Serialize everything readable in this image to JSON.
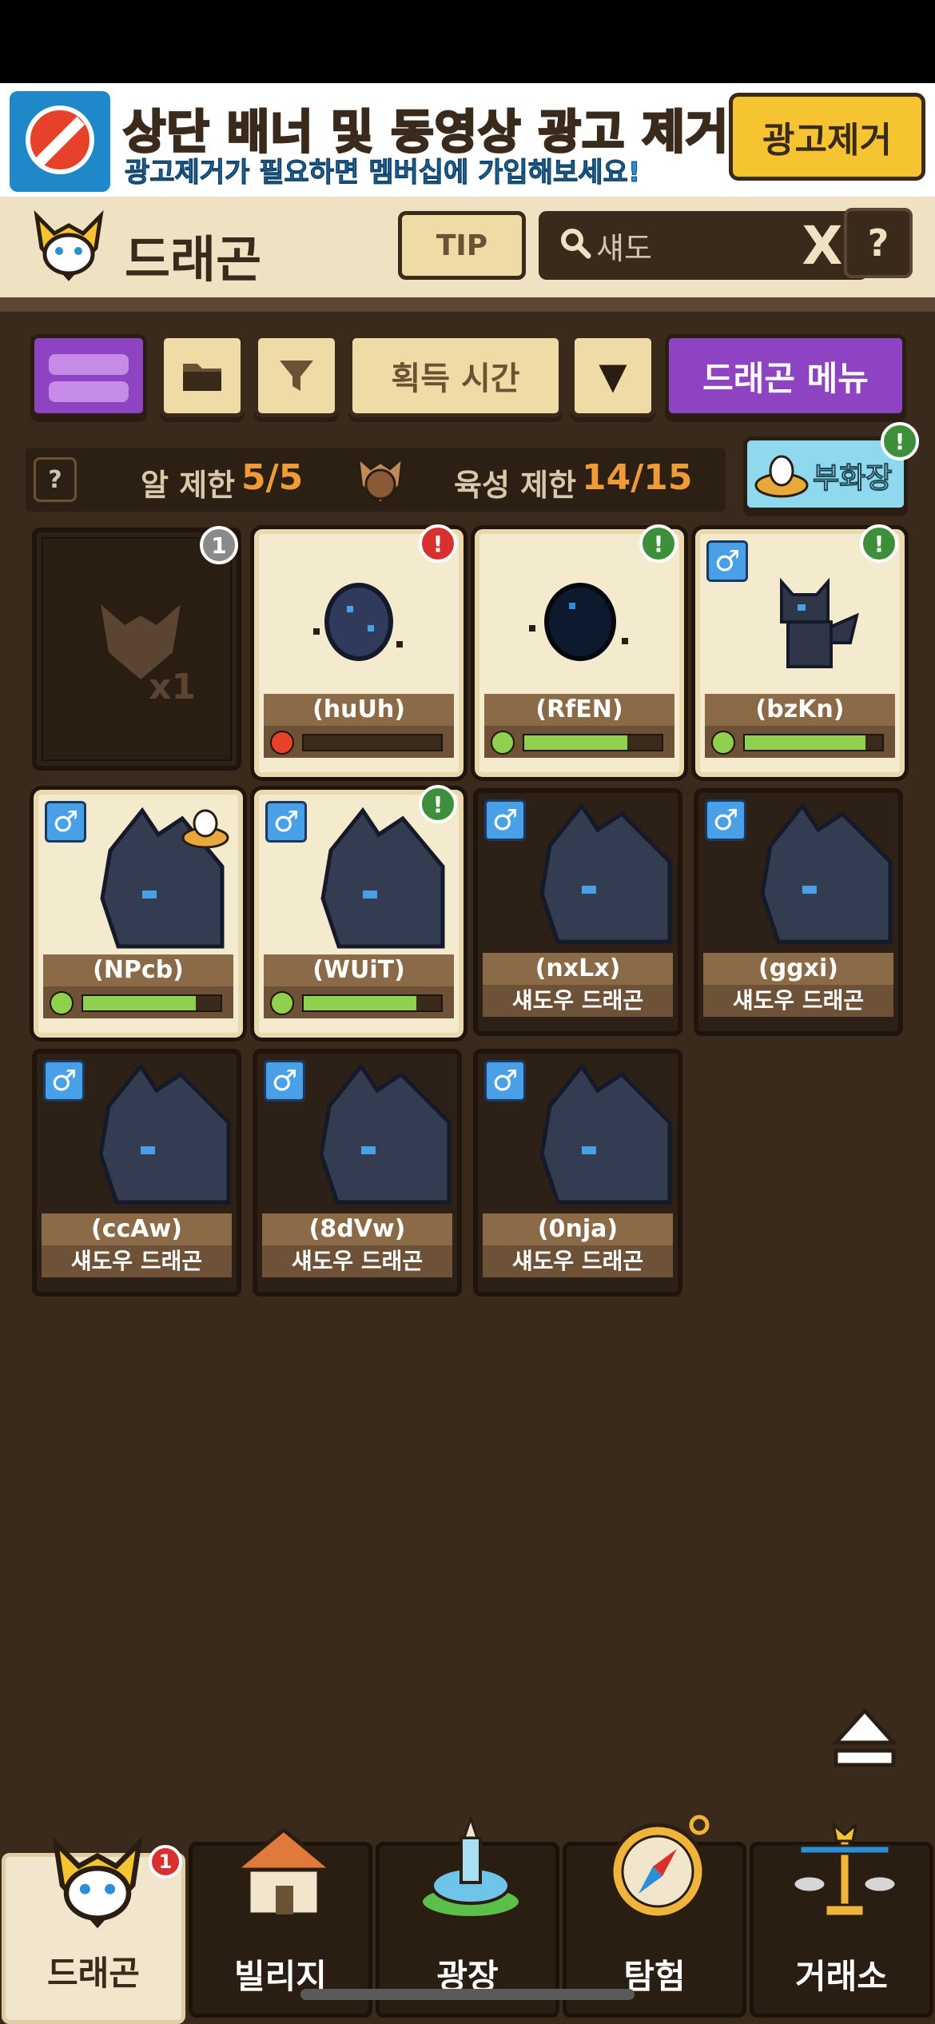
{
  "banner": {
    "title": "상단 배너 및 동영상 광고 제거!",
    "subtitle": "광고제거가 필요하면 멤버십에 가입해보세요!",
    "button_label": "광고제거"
  },
  "header": {
    "title": "드래곤",
    "tip_label": "TIP",
    "search_value": "섀도",
    "clear_label": "X",
    "help_label": "?"
  },
  "toolbar": {
    "sort_label": "획득 시간",
    "sort_dir": "▼",
    "menu_label": "드래곤 메뉴"
  },
  "limits": {
    "help_label": "?",
    "egg_label": "알 제한",
    "egg_value": "5/5",
    "raise_label": "육성 제한",
    "raise_value": "14/15",
    "nursery_label": "부화장",
    "nursery_badge": "!"
  },
  "cards": [
    {
      "type": "placeholder",
      "count": "x1",
      "badge": "1"
    },
    {
      "type": "egg",
      "name": "(huUh)",
      "hp": 0.0,
      "mood": "angry",
      "badge": "!"
    },
    {
      "type": "egg",
      "name": "(RfEN)",
      "hp": 0.75,
      "mood": "happy",
      "badge": "!"
    },
    {
      "type": "baby",
      "name": "(bzKn)",
      "hp": 0.88,
      "mood": "happy",
      "badge": "!",
      "gender": "♂"
    },
    {
      "type": "adult",
      "name": "(NPcb)",
      "hp": 0.82,
      "mood": "happy",
      "gender": "♂"
    },
    {
      "type": "adult",
      "name": "(WUiT)",
      "hp": 0.82,
      "mood": "happy",
      "badge": "!",
      "gender": "♂"
    },
    {
      "type": "adult",
      "name": "(nxLx)",
      "species": "섀도우 드래곤",
      "gender": "♂"
    },
    {
      "type": "adult",
      "name": "(ggxi)",
      "species": "섀도우 드래곤",
      "gender": "♂"
    },
    {
      "type": "adult",
      "name": "(ccAw)",
      "species": "섀도우 드래곤",
      "gender": "♂"
    },
    {
      "type": "adult",
      "name": "(8dVw)",
      "species": "섀도우 드래곤",
      "gender": "♂"
    },
    {
      "type": "adult",
      "name": "(0nja)",
      "species": "섀도우 드래곤",
      "gender": "♂"
    }
  ],
  "tabs": [
    {
      "label": "드래곤",
      "badge": "1"
    },
    {
      "label": "빌리지"
    },
    {
      "label": "광장"
    },
    {
      "label": "탐험"
    },
    {
      "label": "거래소"
    }
  ],
  "icons": {
    "banner": "no-ads-icon",
    "logo": "dragon-logo-icon",
    "search": "search-icon",
    "folder": "folder-icon",
    "filter": "filter-icon",
    "nursery": "egg-nest-icon",
    "scroll_top": "eject-icon"
  },
  "colors": {
    "background": "#3a2a1c",
    "header_bg": "#efe2c3",
    "accent_purple": "#8e43c2",
    "value_orange": "#f09b35",
    "hp_green": "#8fd14f",
    "badge_green": "#3e8f3b",
    "badge_red": "#d8302f"
  }
}
